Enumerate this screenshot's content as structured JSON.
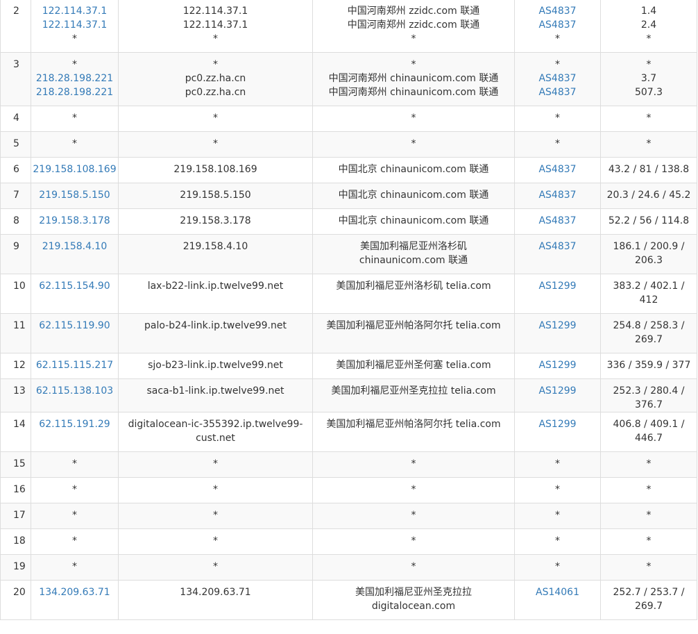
{
  "colors": {
    "link": "#337ab7",
    "text": "#333333",
    "border": "#dddddd",
    "stripe": "#f9f9f9"
  },
  "rows": [
    {
      "hop": "2",
      "ip": [
        "122.114.37.1",
        "122.114.37.1",
        "*"
      ],
      "host": [
        "122.114.37.1",
        "122.114.37.1",
        "*"
      ],
      "loc": [
        "中国河南郑州 zzidc.com 联通",
        "中国河南郑州 zzidc.com 联通",
        "*"
      ],
      "asn": [
        "AS4837",
        "AS4837",
        "*"
      ],
      "lat": [
        "1.4",
        "2.4",
        "*"
      ]
    },
    {
      "hop": "3",
      "ip": [
        "*",
        "218.28.198.221",
        "218.28.198.221"
      ],
      "host": [
        "*",
        "pc0.zz.ha.cn",
        "pc0.zz.ha.cn"
      ],
      "loc": [
        "*",
        "中国河南郑州 chinaunicom.com 联通",
        "中国河南郑州 chinaunicom.com 联通"
      ],
      "asn": [
        "*",
        "AS4837",
        "AS4837"
      ],
      "lat": [
        "*",
        "3.7",
        "507.3"
      ]
    },
    {
      "hop": "4",
      "ip": [
        "*"
      ],
      "host": [
        "*"
      ],
      "loc": [
        "*"
      ],
      "asn": [
        "*"
      ],
      "lat": [
        "*"
      ]
    },
    {
      "hop": "5",
      "ip": [
        "*"
      ],
      "host": [
        "*"
      ],
      "loc": [
        "*"
      ],
      "asn": [
        "*"
      ],
      "lat": [
        "*"
      ]
    },
    {
      "hop": "6",
      "ip": [
        "219.158.108.169"
      ],
      "host": [
        "219.158.108.169"
      ],
      "loc": [
        "中国北京 chinaunicom.com 联通"
      ],
      "asn": [
        "AS4837"
      ],
      "lat": [
        "43.2 / 81 / 138.8"
      ]
    },
    {
      "hop": "7",
      "ip": [
        "219.158.5.150"
      ],
      "host": [
        "219.158.5.150"
      ],
      "loc": [
        "中国北京 chinaunicom.com 联通"
      ],
      "asn": [
        "AS4837"
      ],
      "lat": [
        "20.3 / 24.6 / 45.2"
      ]
    },
    {
      "hop": "8",
      "ip": [
        "219.158.3.178"
      ],
      "host": [
        "219.158.3.178"
      ],
      "loc": [
        "中国北京 chinaunicom.com 联通"
      ],
      "asn": [
        "AS4837"
      ],
      "lat": [
        "52.2 / 56 / 114.8"
      ]
    },
    {
      "hop": "9",
      "ip": [
        "219.158.4.10"
      ],
      "host": [
        "219.158.4.10"
      ],
      "loc": [
        "美国加利福尼亚州洛杉矶",
        "chinaunicom.com 联通"
      ],
      "asn": [
        "AS4837"
      ],
      "lat": [
        "186.1 / 200.9 /",
        "206.3"
      ]
    },
    {
      "hop": "10",
      "ip": [
        "62.115.154.90"
      ],
      "host": [
        "lax-b22-link.ip.twelve99.net"
      ],
      "loc": [
        "美国加利福尼亚州洛杉矶 telia.com"
      ],
      "asn": [
        "AS1299"
      ],
      "lat": [
        "383.2 / 402.1 /",
        "412"
      ]
    },
    {
      "hop": "11",
      "ip": [
        "62.115.119.90"
      ],
      "host": [
        "palo-b24-link.ip.twelve99.net"
      ],
      "loc": [
        "美国加利福尼亚州帕洛阿尔托 telia.com"
      ],
      "asn": [
        "AS1299"
      ],
      "lat": [
        "254.8 / 258.3 /",
        "269.7"
      ]
    },
    {
      "hop": "12",
      "ip": [
        "62.115.115.217"
      ],
      "host": [
        "sjo-b23-link.ip.twelve99.net"
      ],
      "loc": [
        "美国加利福尼亚州圣何塞 telia.com"
      ],
      "asn": [
        "AS1299"
      ],
      "lat": [
        "336 / 359.9 / 377"
      ]
    },
    {
      "hop": "13",
      "ip": [
        "62.115.138.103"
      ],
      "host": [
        "saca-b1-link.ip.twelve99.net"
      ],
      "loc": [
        "美国加利福尼亚州圣克拉拉 telia.com"
      ],
      "asn": [
        "AS1299"
      ],
      "lat": [
        "252.3 / 280.4 /",
        "376.7"
      ]
    },
    {
      "hop": "14",
      "ip": [
        "62.115.191.29"
      ],
      "host": [
        "digitalocean-ic-355392.ip.twelve99-",
        "cust.net"
      ],
      "loc": [
        "美国加利福尼亚州帕洛阿尔托 telia.com"
      ],
      "asn": [
        "AS1299"
      ],
      "lat": [
        "406.8 / 409.1 /",
        "446.7"
      ]
    },
    {
      "hop": "15",
      "ip": [
        "*"
      ],
      "host": [
        "*"
      ],
      "loc": [
        "*"
      ],
      "asn": [
        "*"
      ],
      "lat": [
        "*"
      ]
    },
    {
      "hop": "16",
      "ip": [
        "*"
      ],
      "host": [
        "*"
      ],
      "loc": [
        "*"
      ],
      "asn": [
        "*"
      ],
      "lat": [
        "*"
      ]
    },
    {
      "hop": "17",
      "ip": [
        "*"
      ],
      "host": [
        "*"
      ],
      "loc": [
        "*"
      ],
      "asn": [
        "*"
      ],
      "lat": [
        "*"
      ]
    },
    {
      "hop": "18",
      "ip": [
        "*"
      ],
      "host": [
        "*"
      ],
      "loc": [
        "*"
      ],
      "asn": [
        "*"
      ],
      "lat": [
        "*"
      ]
    },
    {
      "hop": "19",
      "ip": [
        "*"
      ],
      "host": [
        "*"
      ],
      "loc": [
        "*"
      ],
      "asn": [
        "*"
      ],
      "lat": [
        "*"
      ]
    },
    {
      "hop": "20",
      "ip": [
        "134.209.63.71"
      ],
      "host": [
        "134.209.63.71"
      ],
      "loc": [
        "美国加利福尼亚州圣克拉拉",
        "digitalocean.com"
      ],
      "asn": [
        "AS14061"
      ],
      "lat": [
        "252.7 / 253.7 /",
        "269.7"
      ]
    }
  ]
}
